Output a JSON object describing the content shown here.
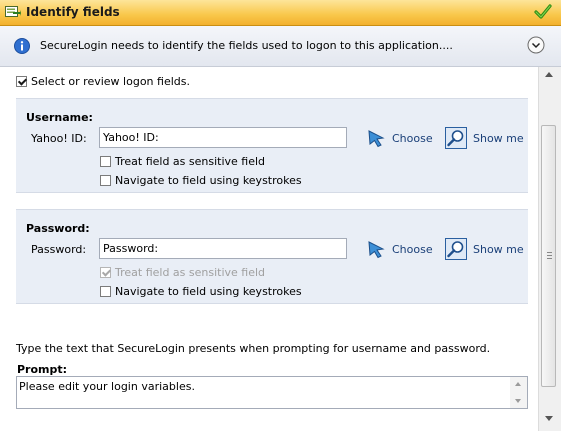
{
  "title_bar": {
    "title": "Identify fields",
    "icons": {
      "app": "form-arrow-icon",
      "confirm": "checkmark-icon"
    },
    "colors": {
      "bar": "#f9c74a",
      "check": "#3aa31a"
    }
  },
  "info": {
    "message": "SecureLogin needs to identify the fields used to logon to this application....",
    "icons": {
      "info": "info-icon",
      "collapse": "chevron-collapse-icon"
    }
  },
  "select_review": {
    "label": "Select or review logon fields.",
    "checked": true
  },
  "username": {
    "heading": "Username:",
    "label": "Yahoo! ID:",
    "value": "Yahoo! ID:",
    "choose_label": "Choose",
    "show_label": "Show me",
    "sensitive": {
      "label": "Treat field as sensitive field",
      "checked": false,
      "disabled": false
    },
    "keystrokes": {
      "label": "Navigate to field using keystrokes",
      "checked": false
    }
  },
  "password": {
    "heading": "Password:",
    "label": "Password:",
    "value": "Password:",
    "choose_label": "Choose",
    "show_label": "Show me",
    "sensitive": {
      "label": "Treat field as sensitive field",
      "checked": true,
      "disabled": true
    },
    "keystrokes": {
      "label": "Navigate to field using keystrokes",
      "checked": false
    }
  },
  "prompt": {
    "instructions": "Type the text that SecureLogin presents when prompting for username and password.",
    "label": "Prompt:",
    "value": "Please edit your login variables."
  },
  "colors": {
    "section_bg": "#e9eef6",
    "link": "#1a3f78",
    "accent": "#2f7fd0"
  }
}
